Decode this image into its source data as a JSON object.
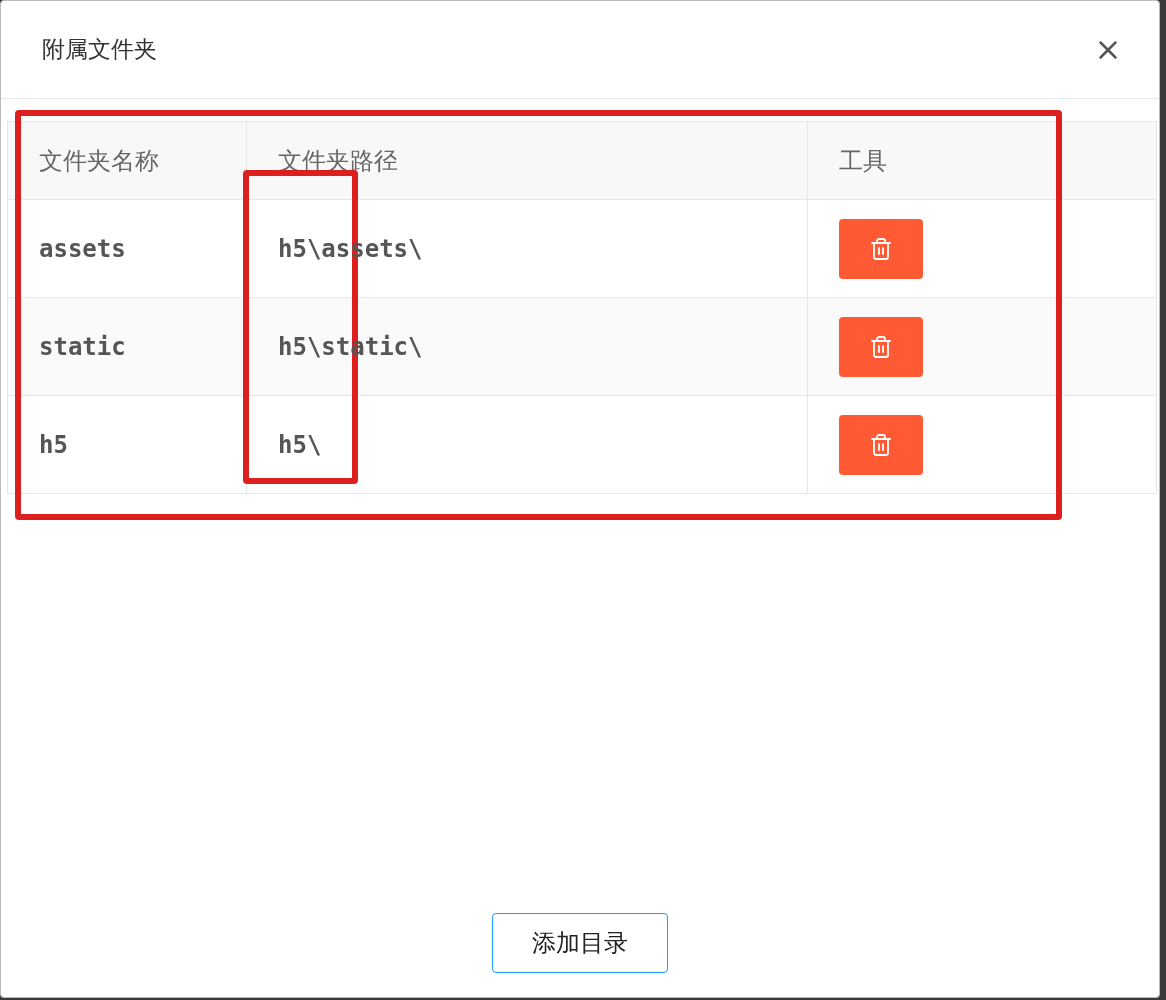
{
  "dialog": {
    "title": "附属文件夹"
  },
  "table": {
    "columns": [
      "文件夹名称",
      "文件夹路径",
      "工具"
    ],
    "rows": [
      {
        "name": "assets",
        "path": "h5\\assets\\"
      },
      {
        "name": "static",
        "path": "h5\\static\\"
      },
      {
        "name": "h5",
        "path": "h5\\"
      }
    ]
  },
  "highlights": {
    "table": true,
    "path_column": true
  },
  "footer": {
    "button": "添加目录"
  }
}
